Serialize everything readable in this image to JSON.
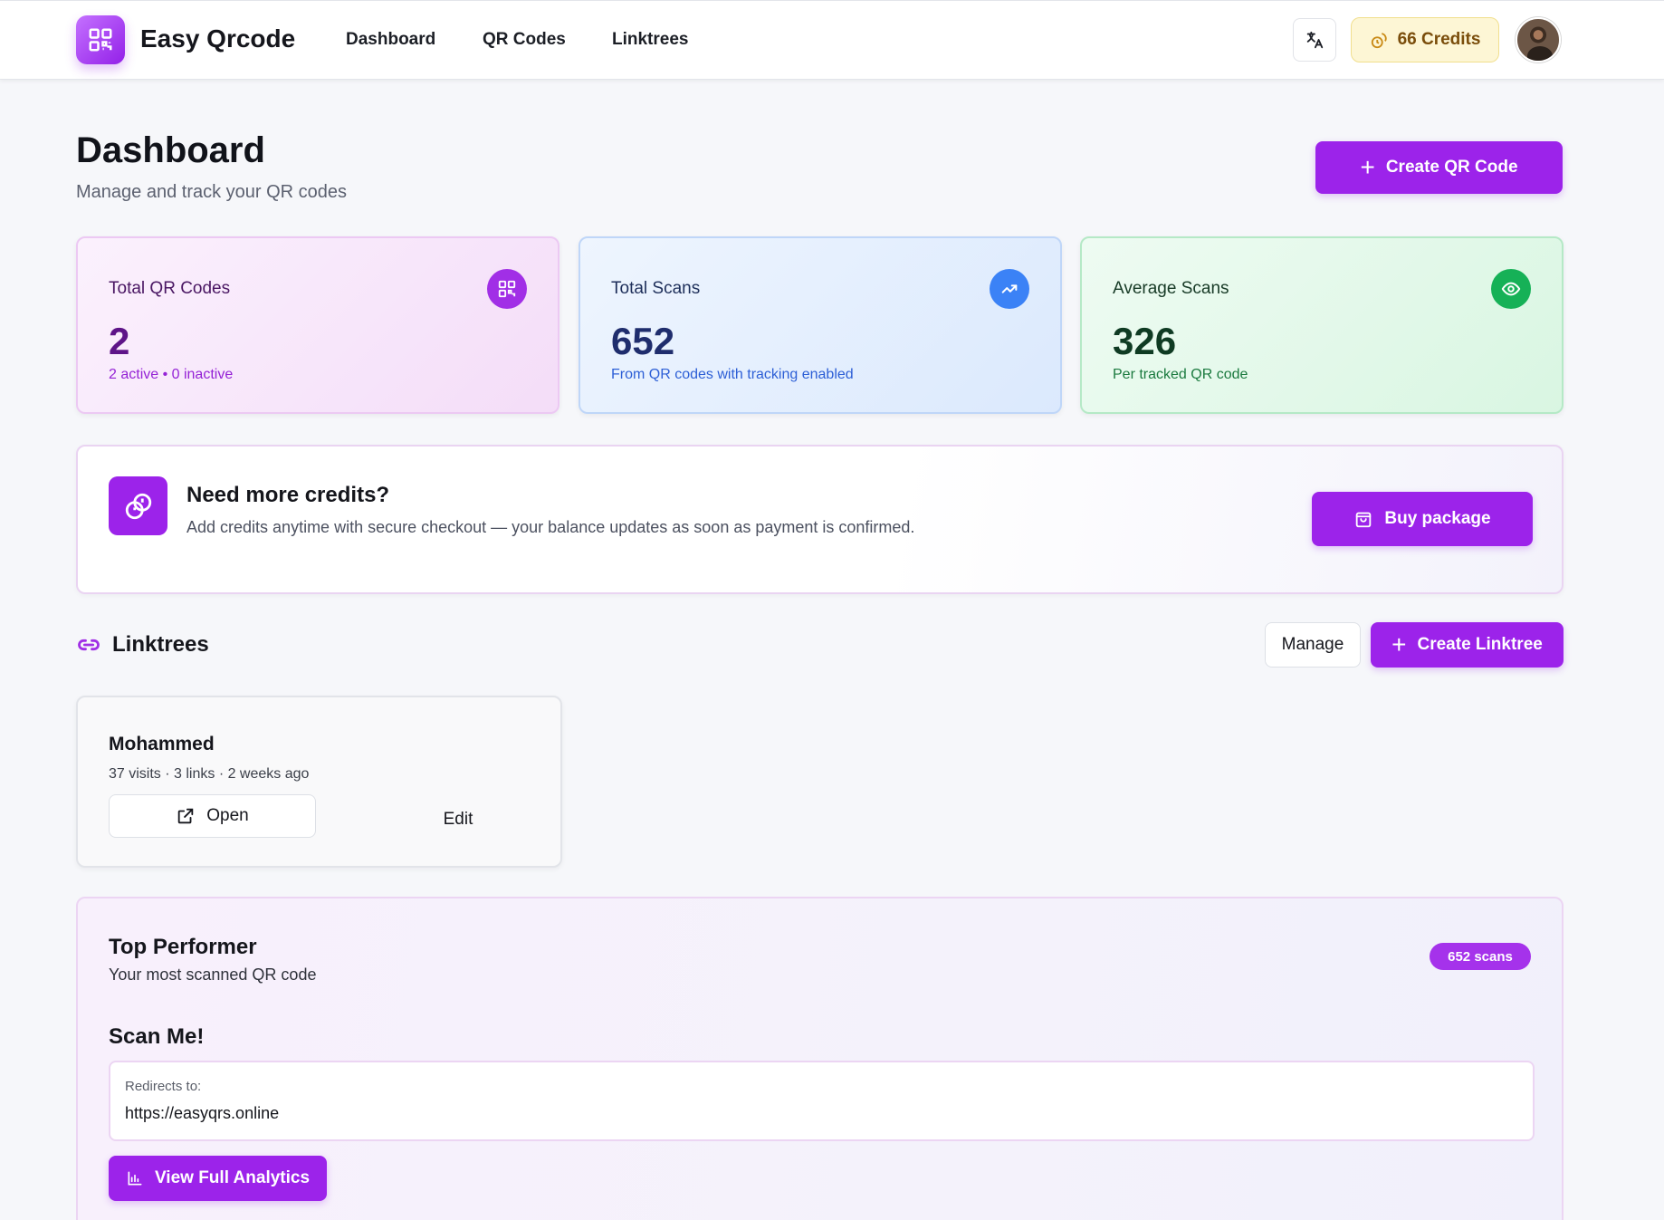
{
  "header": {
    "brand": "Easy Qrcode",
    "nav": [
      "Dashboard",
      "QR Codes",
      "Linktrees"
    ],
    "credits_label": "66 Credits"
  },
  "page": {
    "title": "Dashboard",
    "subtitle": "Manage and track your QR codes",
    "create_button": "Create QR Code"
  },
  "stats": [
    {
      "label": "Total QR Codes",
      "value": "2",
      "note": "2 active • 0 inactive",
      "icon": "qr-code-icon",
      "color": "#a12fe6"
    },
    {
      "label": "Total Scans",
      "value": "652",
      "note": "From QR codes with tracking enabled",
      "icon": "trending-up-icon",
      "color": "#3b82f6"
    },
    {
      "label": "Average Scans",
      "value": "326",
      "note": "Per tracked QR code",
      "icon": "eye-icon",
      "color": "#16b157"
    }
  ],
  "credits_banner": {
    "title": "Need more credits?",
    "description": "Add credits anytime with secure checkout — your balance updates as soon as payment is confirmed.",
    "button": "Buy package"
  },
  "linktrees": {
    "title": "Linktrees",
    "manage_button": "Manage",
    "create_button": "Create Linktree",
    "items": [
      {
        "name": "Mohammed",
        "meta": "37 visits · 3 links · 2 weeks ago",
        "open_label": "Open",
        "edit_label": "Edit"
      }
    ]
  },
  "top_performer": {
    "title": "Top Performer",
    "subtitle": "Your most scanned QR code",
    "badge": "652 scans",
    "qr_name": "Scan Me!",
    "redirect_label": "Redirects to:",
    "redirect_url": "https://easyqrs.online",
    "analytics_button": "View Full Analytics"
  },
  "colors": {
    "accent": "#9c23ea",
    "credits_bg": "#fdf6d5"
  }
}
